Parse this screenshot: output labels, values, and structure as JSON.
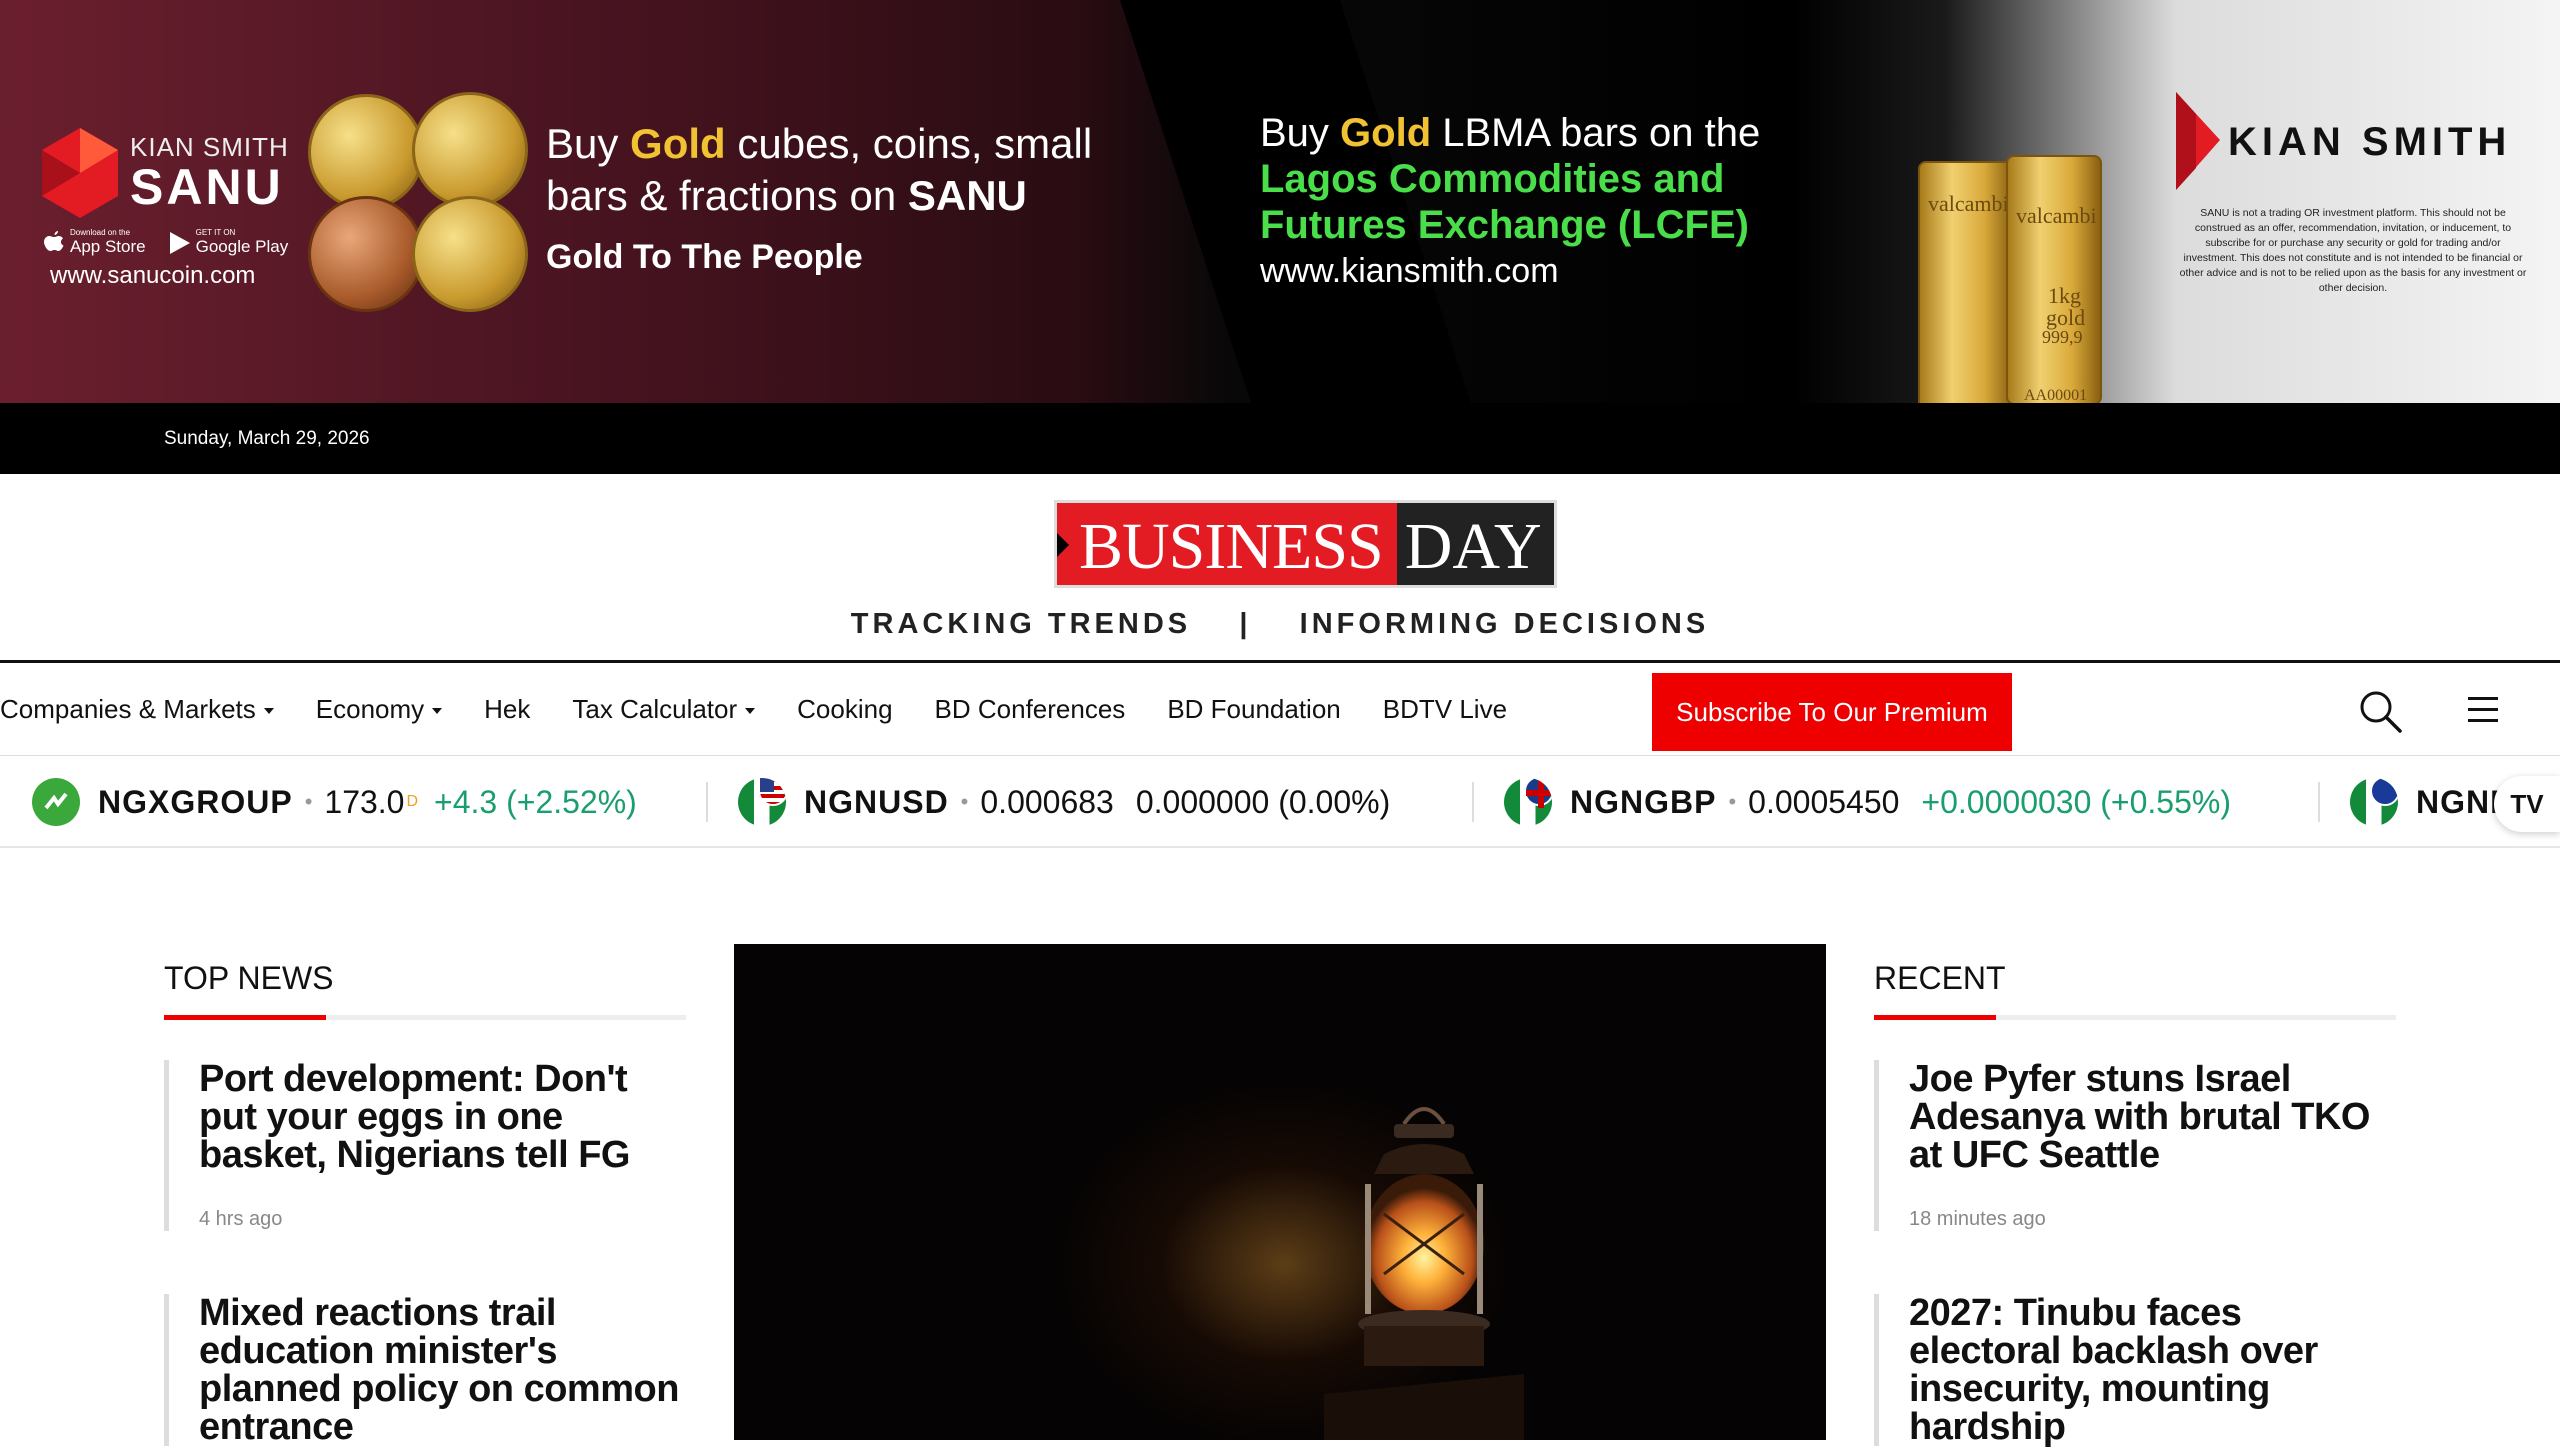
{
  "ad": {
    "sanu_brand_small": "KIAN SMITH",
    "sanu_brand_big": "SANU",
    "app_store": "App Store",
    "app_store_pre": "Download on the",
    "google_play": "Google Play",
    "google_play_pre": "GET IT ON",
    "sanu_url": "www.sanucoin.com",
    "headline1_pre": "Buy ",
    "headline1_gold": "Gold",
    "headline1_post": " cubes, coins, small",
    "headline1_line2_pre": "bars & fractions on ",
    "headline1_line2_bold": "SANU",
    "tagline1": "Gold To The People",
    "headline2_pre": "Buy ",
    "headline2_gold": "Gold",
    "headline2_post": " LBMA bars on the",
    "headline2_green1": "Lagos Commodities and",
    "headline2_green2": "Futures Exchange (LCFE)",
    "headline2_url": "www.kiansmith.com",
    "bar1_text": "valcambi",
    "bar2_text": "valcambi",
    "bar2_weight": "1kg",
    "bar2_metal": "gold",
    "bar2_purity": "999,9",
    "bar2_serial": "AA00001",
    "ks_name": "KIAN SMITH",
    "ks_disclaimer": "SANU is not a trading OR investment platform. This should not be construed as an offer, recommendation, invitation, or inducement, to subscribe for or purchase any security or gold for trading and/or investment. This does not constitute and is not intended to be financial or other advice and is not to be relied upon as the basis for any investment or other decision."
  },
  "datebar": {
    "date": "Sunday, March 29, 2026"
  },
  "masthead": {
    "logo_left": "BUSINESS",
    "logo_right": "DAY",
    "tagline": "TRACKING TRENDS    |    INFORMING DECISIONS"
  },
  "nav": {
    "items": [
      {
        "label": "Companies & Markets",
        "dropdown": true
      },
      {
        "label": "Economy",
        "dropdown": true
      },
      {
        "label": "Hek",
        "dropdown": false
      },
      {
        "label": "Tax Calculator",
        "dropdown": true
      },
      {
        "label": "Cooking",
        "dropdown": false
      },
      {
        "label": "BD Conferences",
        "dropdown": false
      },
      {
        "label": "BD Foundation",
        "dropdown": false
      },
      {
        "label": "BDTV Live",
        "dropdown": false
      }
    ],
    "subscribe": "Subscribe To Our Premium"
  },
  "ticker": [
    {
      "symbol": "NGXGROUP",
      "price": "173.0",
      "flag": "D",
      "change": "+4.3 (+2.52%)",
      "direction": "up"
    },
    {
      "symbol": "NGNUSD",
      "price": "0.000683",
      "change": "0.000000 (0.00%)",
      "direction": "flat"
    },
    {
      "symbol": "NGNGBP",
      "price": "0.0005450",
      "change": "+0.0000030 (+0.55%)",
      "direction": "up"
    },
    {
      "symbol": "NGNE",
      "price": "",
      "change": "",
      "direction": "flat"
    }
  ],
  "ticker_badge": "TV",
  "colors": {
    "accent": "#e00000",
    "positive": "#1a9e6e",
    "brand_red": "#e31b23"
  },
  "top_news": {
    "heading": "TOP NEWS",
    "stories": [
      {
        "title": "Port development: Don't put your eggs in one basket, Nigerians tell FG",
        "time": "4 hrs ago"
      },
      {
        "title": "Mixed reactions trail education minister's planned policy on common entrance",
        "time": ""
      }
    ]
  },
  "recent": {
    "heading": "RECENT",
    "stories": [
      {
        "title": "Joe Pyfer stuns Israel Adesanya with brutal TKO at UFC Seattle",
        "time": "18 minutes ago"
      },
      {
        "title": "2027: Tinubu faces electoral backlash over insecurity, mounting hardship",
        "time": ""
      }
    ]
  }
}
